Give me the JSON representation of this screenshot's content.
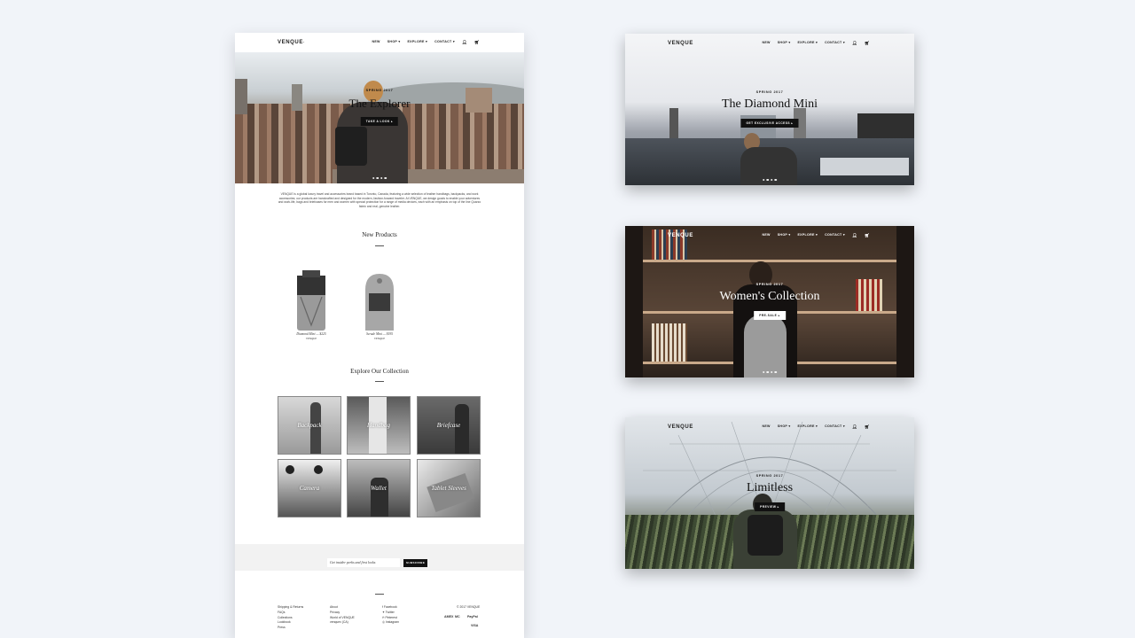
{
  "brand": "VENQUE",
  "nav": {
    "items": [
      "NEW",
      "SHOP ▾",
      "EXPLORE ▾",
      "CONTACT ▾"
    ],
    "user_icon": "user-icon",
    "cart_icon": "cart-icon"
  },
  "main": {
    "hero": {
      "kicker": "SPRING 2017",
      "title": "The Explorer",
      "cta": "TAKE A LOOK ▸"
    },
    "intro": "VENQUE is a global luxury travel and accessories brand based in Toronto, Canada, featuring a wide selection of leather handbags, backpacks, and work accessories; our products are handcrafted and designed for the modern, fashion-forward traveler. At VENQUE, we design goods to enable your adventures and work-life, bags and briefcases for men and women with special protection for a range of media devices, each with an emphasis on top of the line Quarzo fabric and real, genuine leather.",
    "new_products": {
      "title": "New Products",
      "items": [
        {
          "name": "Diamond Mini — $225",
          "brand": "VENQUE"
        },
        {
          "name": "Scrude Mini — $195",
          "brand": "VENQUE"
        }
      ]
    },
    "collection": {
      "title": "Explore Our Collection",
      "tiles": [
        "Backpack",
        "Handbag",
        "Briefcase",
        "Camera",
        "Wallet",
        "Tablet Sleeves"
      ]
    },
    "newsletter": {
      "placeholder": "Get insider perks and first looks",
      "button": "SUBSCRIBE"
    },
    "footer": {
      "col1": [
        "Shipping & Returns",
        "FAQs",
        "Collections",
        "Lookbook",
        "Press"
      ],
      "col2": [
        "About",
        "Privacy",
        "World of VENQUE",
        "venquex (CA)"
      ],
      "col3": [
        "Facebook",
        "Twitter",
        "Pinterest",
        "Instagram"
      ],
      "copyright": "© 2017 VENQUE",
      "payments": [
        "AMEX",
        "MC",
        "PayPal",
        "VISA"
      ]
    }
  },
  "mocks": [
    {
      "kicker": "SPRING 2017",
      "title": "The Diamond Mini",
      "cta": "GET EXCLUSIVE ACCESS ▸"
    },
    {
      "kicker": "SPRING 2017",
      "title": "Women's Collection",
      "cta": "PRE-SALE ▸"
    },
    {
      "kicker": "SPRING 2017",
      "title": "Limitless",
      "cta": "PREVIEW ▸"
    }
  ]
}
